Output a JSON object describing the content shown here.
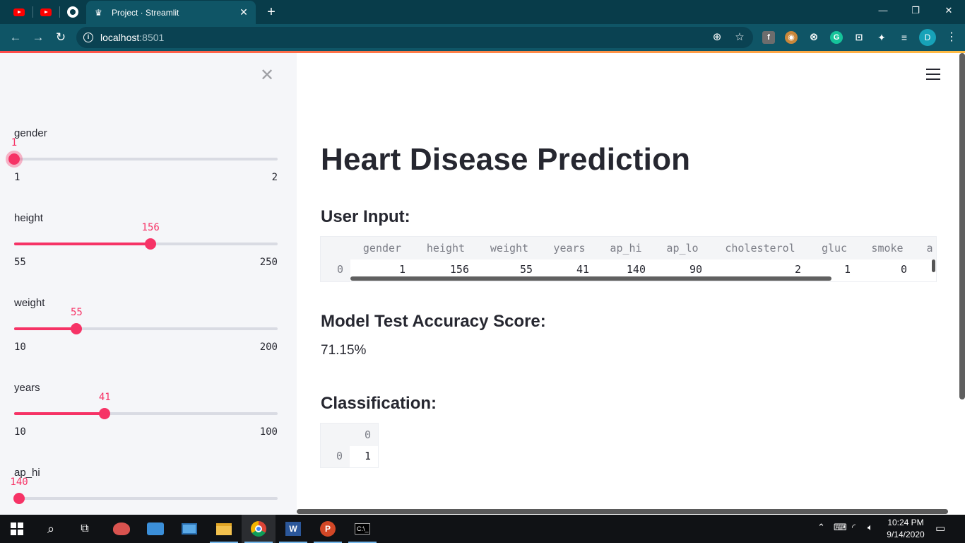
{
  "browser": {
    "tab_title": "Project · Streamlit",
    "tab_close": "✕",
    "new_tab": "+",
    "url_host": "localhost",
    "url_port": ":8501",
    "profile_initial": "D",
    "window_controls": {
      "minimize": "—",
      "restore": "❐",
      "close": "✕"
    }
  },
  "sidebar": {
    "close_glyph": "✕",
    "sliders": [
      {
        "label": "gender",
        "value": "1",
        "min": "1",
        "max": "2",
        "fraction": 0.0
      },
      {
        "label": "height",
        "value": "156",
        "min": "55",
        "max": "250",
        "fraction": 0.518
      },
      {
        "label": "weight",
        "value": "55",
        "min": "10",
        "max": "200",
        "fraction": 0.237
      },
      {
        "label": "years",
        "value": "41",
        "min": "10",
        "max": "100",
        "fraction": 0.344
      },
      {
        "label": "ap_hi",
        "value": "140",
        "min": "",
        "max": "",
        "fraction": 0.019
      }
    ]
  },
  "main": {
    "title": "Heart Disease Prediction",
    "user_input_heading": "User Input:",
    "accuracy_heading": "Model Test Accuracy Score:",
    "accuracy_value": "71.15%",
    "classification_heading": "Classification:",
    "user_input_table": {
      "columns": [
        "gender",
        "height",
        "weight",
        "years",
        "ap_hi",
        "ap_lo",
        "cholesterol",
        "gluc",
        "smoke",
        "a"
      ],
      "rows": [
        {
          "index": "0",
          "values": [
            "1",
            "156",
            "55",
            "41",
            "140",
            "90",
            "2",
            "1",
            "0",
            ""
          ]
        }
      ]
    },
    "classification_table": {
      "column": "0",
      "index": "0",
      "value": "1"
    }
  },
  "taskbar": {
    "time": "10:24 PM",
    "date": "9/14/2020"
  },
  "colors": {
    "accent": "#f63366",
    "chrome_dark": "#083c4a",
    "chrome_toolbar": "#0f5566",
    "sidebar_bg": "#f5f6f9",
    "text": "#262730"
  }
}
